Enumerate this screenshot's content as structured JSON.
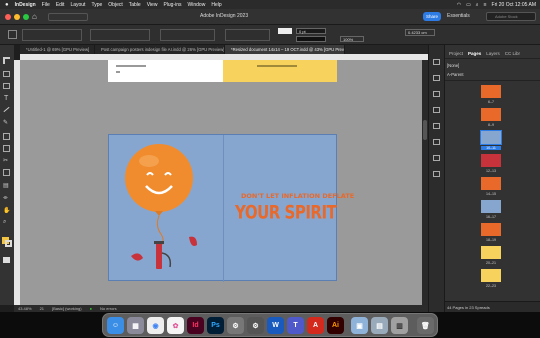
{
  "menubar": {
    "app_name": "InDesign",
    "items": [
      "File",
      "Edit",
      "Layout",
      "Type",
      "Object",
      "Table",
      "View",
      "Plug-ins",
      "Window",
      "Help"
    ],
    "clock": "Fri 20 Oct  12:05 AM"
  },
  "appbar": {
    "title": "Adobe InDesign 2023",
    "share_label": "Share",
    "workspace_label": "Essentials",
    "search_placeholder": "Adobe Stock"
  },
  "toolbar": {
    "stroke_weight": "0 pt",
    "zoom_percent": "100%",
    "dimension_value": "0.4233 cm"
  },
  "tabs": [
    {
      "label": "*Untitled-1 @ 69% [GPU Preview]",
      "active": false
    },
    {
      "label": "Post campaign posters indesign file AI.indd @ 26% [GPU Preview]",
      "active": false
    },
    {
      "label": "*Resized document 14x14 – 19 OCT.indd @ 43% [GPU Preview]",
      "active": true
    }
  ],
  "poster": {
    "tagline": "DON'T LET INFLATION DEFLATE",
    "headline": "YOUR SPIRIT"
  },
  "statusbar": {
    "zoom": "43.48%",
    "page": "21",
    "style": "[Basic] (working)",
    "errors": "No errors"
  },
  "pages_panel": {
    "tabs": [
      "Project",
      "Pages",
      "Layers",
      "CC Libr"
    ],
    "active_tab": "Pages",
    "masters": [
      "[None]",
      "A-Parent"
    ],
    "spreads": [
      "6–7",
      "8–9",
      "10–11",
      "12–13",
      "14–15",
      "16–17",
      "18–19",
      "20–21",
      "22–23"
    ],
    "footer": "44 Pages in 23 Spreads"
  },
  "dock_apps": [
    "Finder",
    "Launchpad",
    "Chrome",
    "Photos",
    "InDesign",
    "Photoshop",
    "System Settings",
    "Settings",
    "Word",
    "Teams",
    "Acrobat",
    "Illustrator",
    "Preview",
    "Notes",
    "Trash"
  ],
  "colors": {
    "poster_blue": "#87a6cf",
    "balloon_orange": "#f08c2e",
    "headline_orange": "#e8692a",
    "indesign_pink": "#ff3366",
    "accent_blue": "#2d7be5"
  }
}
